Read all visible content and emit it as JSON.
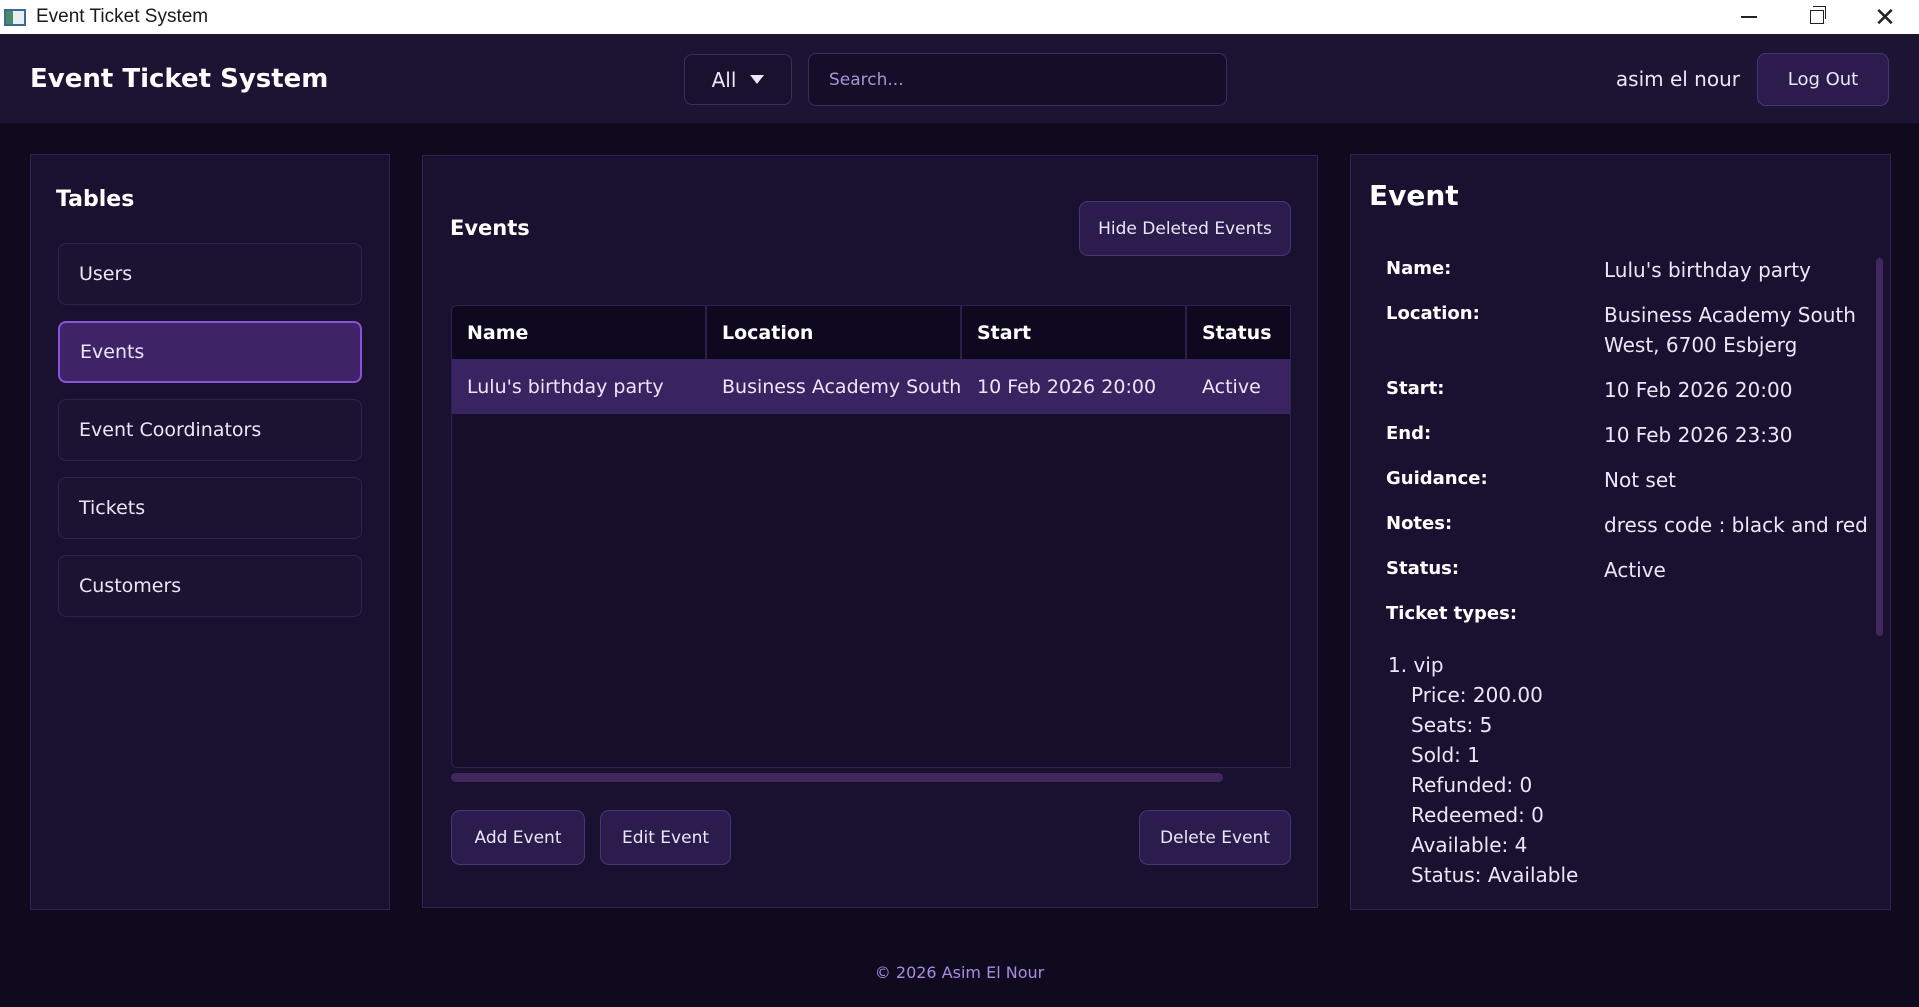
{
  "window": {
    "title": "Event Ticket System"
  },
  "header": {
    "app_title": "Event Ticket System",
    "filter": {
      "selected": "All"
    },
    "search": {
      "placeholder": "Search..."
    },
    "user_name": "asim el nour",
    "logout_label": "Log Out"
  },
  "sidebar": {
    "heading": "Tables",
    "items": [
      {
        "label": "Users"
      },
      {
        "label": "Events"
      },
      {
        "label": "Event Coordinators"
      },
      {
        "label": "Tickets"
      },
      {
        "label": "Customers"
      }
    ]
  },
  "events_panel": {
    "heading": "Events",
    "hide_deleted_label": "Hide Deleted Events",
    "columns": [
      "Name",
      "Location",
      "Start",
      "Status"
    ],
    "rows": [
      {
        "name": "Lulu's birthday party",
        "location": "Business Academy South...",
        "start": "10 Feb 2026 20:00",
        "status": "Active"
      }
    ],
    "add_label": "Add Event",
    "edit_label": "Edit Event",
    "delete_label": "Delete Event"
  },
  "detail": {
    "heading": "Event",
    "fields": [
      {
        "label": "Name:",
        "value": "Lulu's birthday party"
      },
      {
        "label": "Location:",
        "value": "Business Academy South West, 6700 Esbjerg"
      },
      {
        "label": "Start:",
        "value": "10 Feb 2026 20:00"
      },
      {
        "label": "End:",
        "value": "10 Feb 2026 23:30"
      },
      {
        "label": "Guidance:",
        "value": "Not set"
      },
      {
        "label": "Notes:",
        "value": "dress code : black and red"
      },
      {
        "label": "Status:",
        "value": "Active"
      }
    ],
    "ticket_types_label": "Ticket types:",
    "ticket_types": [
      {
        "title": "1. vip",
        "price": "Price: 200.00",
        "seats": "Seats: 5",
        "sold": "Sold: 1",
        "refunded": "Refunded: 0",
        "redeemed": "Redeemed: 0",
        "available": "Available: 4",
        "status": "Status: Available"
      }
    ]
  },
  "footer": {
    "text": "© 2026 Asim El Nour"
  },
  "colors": {
    "background": "#100a1f",
    "panel": "#1a1130",
    "accent": "#8a52d6",
    "selected_row": "#3a2361",
    "button": "#2c1c4e"
  }
}
